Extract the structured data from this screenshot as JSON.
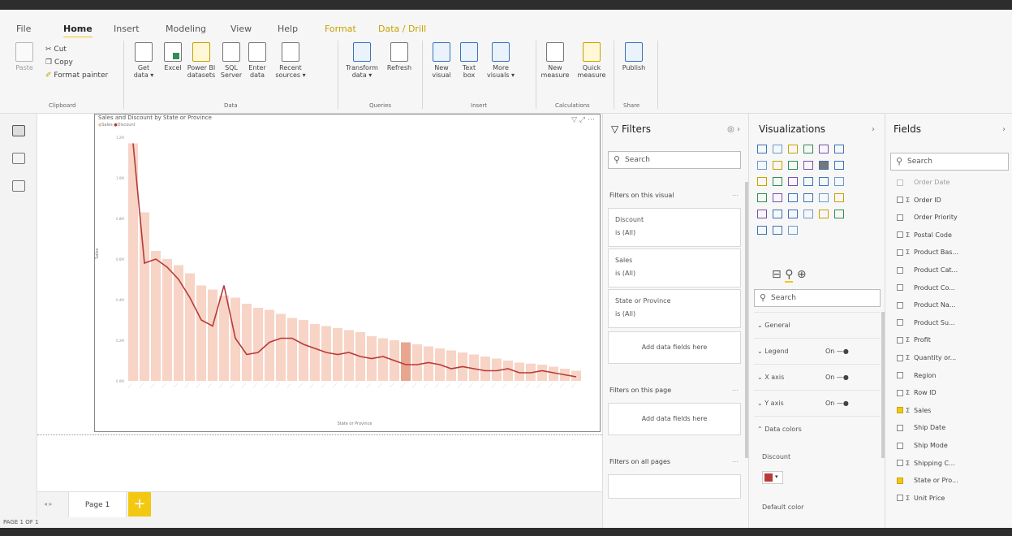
{
  "menu_tabs": [
    {
      "label": "File"
    },
    {
      "label": "Home"
    },
    {
      "label": "Insert"
    },
    {
      "label": "Modeling"
    },
    {
      "label": "View"
    },
    {
      "label": "Help"
    },
    {
      "label": "Format"
    },
    {
      "label": "Data / Drill"
    }
  ],
  "clipboard": {
    "paste": "Paste",
    "cut": "Cut",
    "copy": "Copy",
    "format_painter": "Format painter",
    "group": "Clipboard"
  },
  "data_group": {
    "get_data": "Get data ▾",
    "excel": "Excel",
    "power_bi": "Power BI datasets",
    "sql": "SQL Server",
    "enter": "Enter data",
    "recent": "Recent sources ▾",
    "group": "Data"
  },
  "queries_group": {
    "transform": "Transform data ▾",
    "refresh": "Refresh",
    "group": "Queries"
  },
  "insert_group": {
    "new_visual": "New visual",
    "text_box": "Text box",
    "more_visuals": "More visuals ▾",
    "group": "Insert"
  },
  "calc_group": {
    "new_measure": "New measure",
    "quick_measure": "Quick measure",
    "group": "Calculations"
  },
  "share_group": {
    "publish": "Publish",
    "group": "Share"
  },
  "visual": {
    "title": "Sales and Discount by State or Province",
    "legend_sales": "Sales",
    "legend_discount": "Discount",
    "y_axis_label": "Sales",
    "x_axis_label": "State or Province"
  },
  "chart_data": {
    "type": "bar",
    "title": "Sales and Discount by State or Province",
    "xlabel": "State or Province",
    "ylabel": "Sales",
    "y_ticks": [
      "1.2M",
      "1.0M",
      "0.8M",
      "0.6M",
      "0.4M",
      "0.2M",
      "0.0M"
    ],
    "ylim": [
      0,
      1.2
    ],
    "categories_count": 40,
    "series": [
      {
        "name": "Sales",
        "color": "#f7d4c6",
        "values": [
          1.17,
          0.83,
          0.64,
          0.6,
          0.57,
          0.53,
          0.47,
          0.45,
          0.42,
          0.41,
          0.38,
          0.36,
          0.35,
          0.33,
          0.31,
          0.3,
          0.28,
          0.27,
          0.26,
          0.25,
          0.24,
          0.22,
          0.21,
          0.2,
          0.19,
          0.18,
          0.17,
          0.16,
          0.15,
          0.14,
          0.13,
          0.12,
          0.11,
          0.1,
          0.09,
          0.085,
          0.08,
          0.07,
          0.06,
          0.05
        ]
      },
      {
        "name": "Discount",
        "color": "#b83a3a",
        "values": [
          1.17,
          0.58,
          0.6,
          0.56,
          0.5,
          0.41,
          0.3,
          0.27,
          0.47,
          0.21,
          0.13,
          0.14,
          0.19,
          0.21,
          0.21,
          0.18,
          0.16,
          0.14,
          0.13,
          0.14,
          0.12,
          0.11,
          0.12,
          0.1,
          0.08,
          0.08,
          0.09,
          0.08,
          0.06,
          0.07,
          0.06,
          0.05,
          0.05,
          0.06,
          0.04,
          0.04,
          0.05,
          0.04,
          0.03,
          0.02
        ]
      }
    ],
    "highlight_index": 24
  },
  "filters": {
    "title": "Filters",
    "search": "Search",
    "on_visual": "Filters on this visual",
    "cards": [
      {
        "name": "Discount",
        "value": "is (All)"
      },
      {
        "name": "Sales",
        "value": "is (All)"
      },
      {
        "name": "State or Province",
        "value": "is (All)"
      }
    ],
    "add_fields": "Add data fields here",
    "on_page": "Filters on this page",
    "on_all_pages": "Filters on all pages"
  },
  "visualizations": {
    "title": "Visualizations",
    "search": "Search",
    "rows": [
      {
        "label": "General"
      },
      {
        "label": "Legend",
        "toggle": "On"
      },
      {
        "label": "X axis",
        "toggle": "On"
      },
      {
        "label": "Y axis",
        "toggle": "On"
      },
      {
        "label": "Data colors"
      }
    ],
    "discount_label": "Discount",
    "default_color": "Default color",
    "colors": {
      "discount_swatch": "#b83a3a"
    }
  },
  "fields": {
    "title": "Fields",
    "search": "Search",
    "items": [
      {
        "label": "Order Date",
        "sigma": "",
        "checked": false
      },
      {
        "label": "Order ID",
        "sigma": "Σ",
        "checked": false
      },
      {
        "label": "Order Priority",
        "sigma": "",
        "checked": false
      },
      {
        "label": "Postal Code",
        "sigma": "Σ",
        "checked": false
      },
      {
        "label": "Product Bas...",
        "sigma": "Σ",
        "checked": false
      },
      {
        "label": "Product Cat...",
        "sigma": "",
        "checked": false
      },
      {
        "label": "Product Co...",
        "sigma": "",
        "checked": false
      },
      {
        "label": "Product Na...",
        "sigma": "",
        "checked": false
      },
      {
        "label": "Product Su...",
        "sigma": "",
        "checked": false
      },
      {
        "label": "Profit",
        "sigma": "Σ",
        "checked": false
      },
      {
        "label": "Quantity or...",
        "sigma": "Σ",
        "checked": false
      },
      {
        "label": "Region",
        "sigma": "",
        "checked": false
      },
      {
        "label": "Row ID",
        "sigma": "Σ",
        "checked": false
      },
      {
        "label": "Sales",
        "sigma": "Σ",
        "checked": true
      },
      {
        "label": "Ship Date",
        "sigma": "",
        "checked": false
      },
      {
        "label": "Ship Mode",
        "sigma": "",
        "checked": false
      },
      {
        "label": "Shipping C...",
        "sigma": "Σ",
        "checked": false
      },
      {
        "label": "State or Pro...",
        "sigma": "",
        "checked": true
      },
      {
        "label": "Unit Price",
        "sigma": "Σ",
        "checked": false
      }
    ]
  },
  "pages": {
    "page1": "Page 1",
    "add": "+",
    "status": "PAGE 1 OF 1"
  },
  "accent": "#f2c811"
}
